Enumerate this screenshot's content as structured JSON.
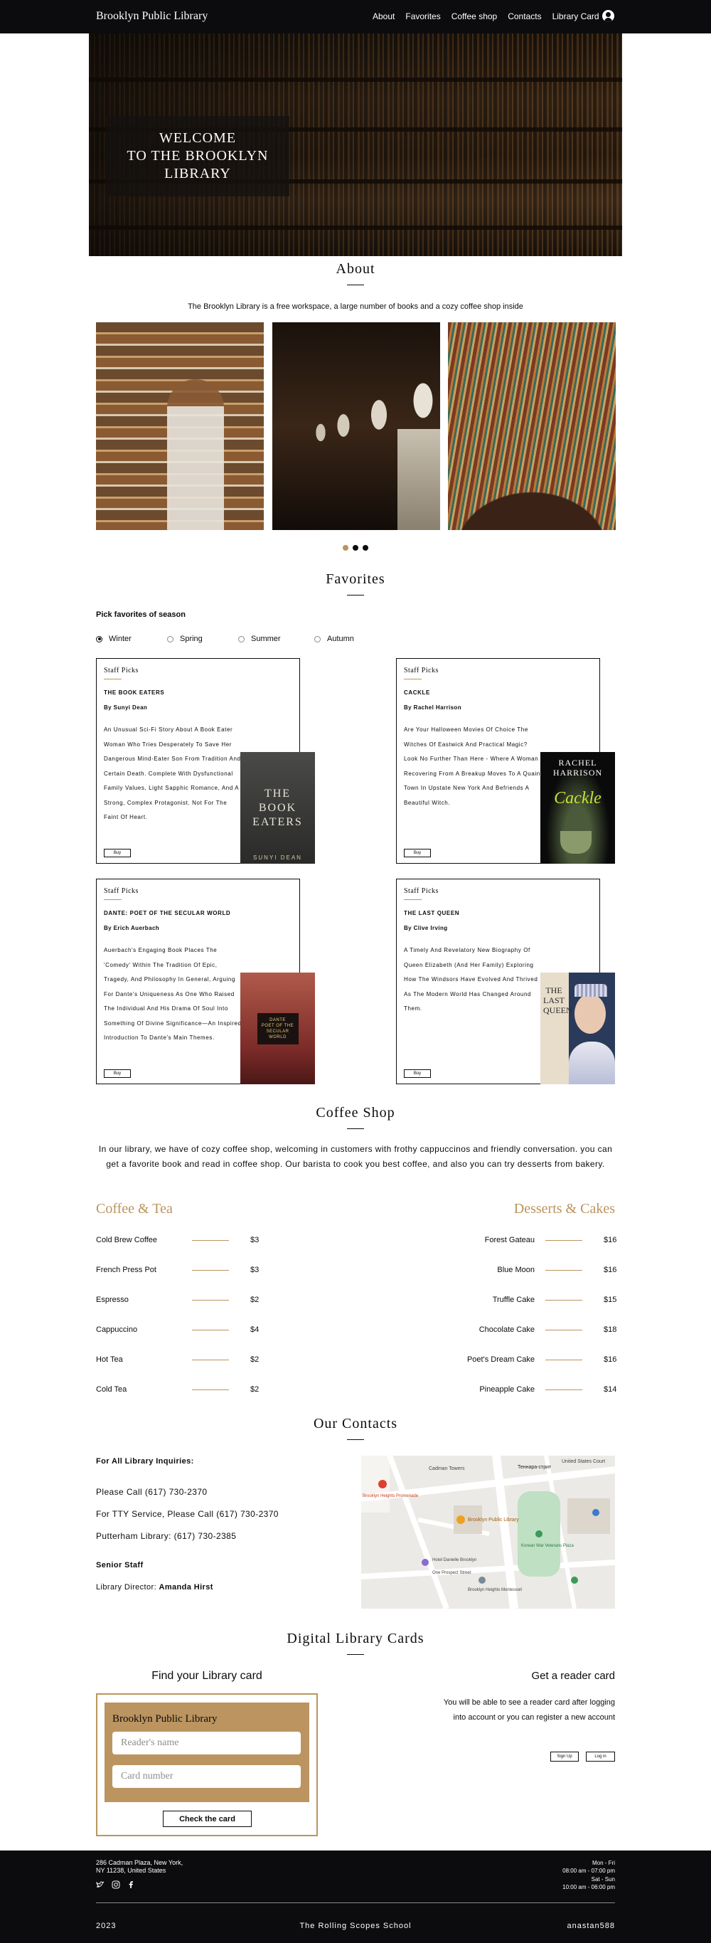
{
  "header": {
    "logo": "Brooklyn Public Library",
    "nav": [
      "About",
      "Favorites",
      "Coffee shop",
      "Contacts",
      "Library Card"
    ]
  },
  "hero": {
    "welcome": "WELCOME\nTO THE BROOKLYN\nLIBRARY"
  },
  "about": {
    "title": "About",
    "text": "The Brooklyn Library is a free workspace, a large number of books and a cozy coffee shop inside"
  },
  "favorites": {
    "title": "Favorites",
    "pick_label": "Pick favorites of season",
    "seasons": [
      "Winter",
      "Spring",
      "Summer",
      "Autumn"
    ],
    "selected_season": "Winter",
    "staff_picks": "Staff Picks",
    "buy": "Buy",
    "books": [
      {
        "title": "THE BOOK EATERS",
        "author": "By Sunyi Dean",
        "description": "An unusual sci-fi story about a book eater woman who tries desperately to save her dangerous mind-eater son from tradition and certain death. Complete with dysfunctional family values, light sapphic romance, and a strong, complex protagonist. Not for the faint of heart.",
        "cover_title": "THE\nBOOK\nEATERS",
        "cover_author": "SUNYI DEAN"
      },
      {
        "title": "CACKLE",
        "author": "By Rachel Harrison",
        "description": "Are your Halloween movies of choice The Witches of Eastwick and Practical Magic? Look no further than here - where a woman recovering from a breakup moves to a quaint town in upstate New York and befriends a beautiful witch.",
        "cover_title": "Cackle",
        "cover_author": "RACHEL\nHARRISON"
      },
      {
        "title": "DANTE: POET OF THE SECULAR WORLD",
        "author": "By Erich Auerbach",
        "description": "Auerbach's engaging book places the 'Comedy' within the tradition of epic, tragedy, and philosophy in general, arguing for Dante's uniqueness as one who raised the individual and his drama of soul into something of divine significance—an inspired introduction to Dante's main themes.",
        "cover_title": "DANTE\nPOET OF THE\nSECULAR WORLD"
      },
      {
        "title": "THE LAST QUEEN",
        "author": "By Clive Irving",
        "description": "A timely and revelatory new biography of Queen Elizabeth (and her family) exploring how the Windsors have evolved and thrived as the modern world has changed around them.",
        "cover_title": "THE\nLAST\nQUEEN"
      }
    ]
  },
  "coffee": {
    "title": "Coffee Shop",
    "text": "In our library, we have of cozy coffee shop, welcoming in customers with frothy cappuccinos and friendly conversation. you can get a favorite book and read in coffee shop. Our barista to cook you best coffee, and also you can try desserts from bakery.",
    "left_title": "Coffee & Tea",
    "right_title": "Desserts & Cakes",
    "left_items": [
      {
        "name": "Cold Brew Coffee",
        "price": "$3"
      },
      {
        "name": "French Press Pot",
        "price": "$3"
      },
      {
        "name": "Espresso",
        "price": "$2"
      },
      {
        "name": "Cappuccino",
        "price": "$4"
      },
      {
        "name": "Hot Tea",
        "price": "$2"
      },
      {
        "name": "Cold Tea",
        "price": "$2"
      }
    ],
    "right_items": [
      {
        "name": "Forest Gateau",
        "price": "$16"
      },
      {
        "name": "Blue Moon",
        "price": "$16"
      },
      {
        "name": "Truffle Cake",
        "price": "$15"
      },
      {
        "name": "Chocolate Cake",
        "price": "$18"
      },
      {
        "name": "Poet's Dream Cake",
        "price": "$16"
      },
      {
        "name": "Pineapple Cake",
        "price": "$14"
      }
    ]
  },
  "contacts": {
    "title": "Our Contacts",
    "inquiries": "For All Library Inquiries:",
    "call": "Please Call (617) 730-2370",
    "tty": "For TTY Service, Please Call (617) 730-2370",
    "putterham": "Putterham Library: (617) 730-2385",
    "senior": "Senior Staff",
    "director_label": "Library Director: ",
    "director_name": "Amanda Hirst",
    "map_labels": [
      "Cadman Towers",
      "Теннара-стрит",
      "United States Court",
      "Brooklyn Heights Promenade",
      "Brooklyn Public Library",
      "Korean War Veterans Plaza",
      "Hotel Danielle Brooklyn",
      "One Prospect Street",
      "Brooklyn Heights Montessori"
    ]
  },
  "cards": {
    "title": "Digital Library Cards",
    "find": "Find your Library card",
    "box_title": "Brooklyn Public Library",
    "name_placeholder": "Reader's name",
    "number_placeholder": "Card number",
    "check": "Check the card",
    "get": "Get a reader card",
    "get_text": "You will be able to see a reader card after logging into account or you can register a new account",
    "signup": "Sign Up",
    "login": "Log in"
  },
  "footer": {
    "address": "286 Cadman Plaza, New York,\nNY 11238, United States",
    "hours1": "Mon - Fri\n08:00 am - 07:00 pm",
    "hours2": "Sat - Sun\n10:00 am - 06:00 pm",
    "year": "2023",
    "school": "The Rolling Scopes School",
    "author": "anastan588"
  },
  "colors": {
    "accent": "#bb945f",
    "dark": "#0c0c0e"
  }
}
